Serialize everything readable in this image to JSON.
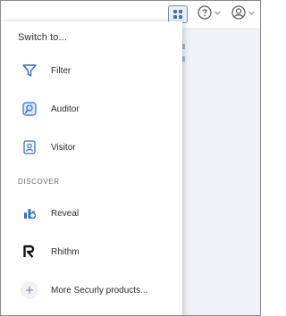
{
  "topbar": {
    "apps_icon": "grid-icon",
    "help_icon": "help-circle-icon",
    "user_icon": "user-avatar-icon"
  },
  "menu": {
    "title": "Switch to...",
    "items": [
      {
        "label": "Filter",
        "icon": "filter-icon"
      },
      {
        "label": "Auditor",
        "icon": "auditor-icon"
      },
      {
        "label": "Visitor",
        "icon": "visitor-icon"
      }
    ],
    "discover_label": "DISCOVER",
    "discover_items": [
      {
        "label": "Reveal",
        "icon": "reveal-icon"
      },
      {
        "label": "Rhithm",
        "icon": "rhithm-icon"
      },
      {
        "label": "More Securly products...",
        "icon": "plus-icon"
      }
    ]
  },
  "colors": {
    "accent": "#2f6fd6",
    "muted_bg": "#eef2f7"
  }
}
